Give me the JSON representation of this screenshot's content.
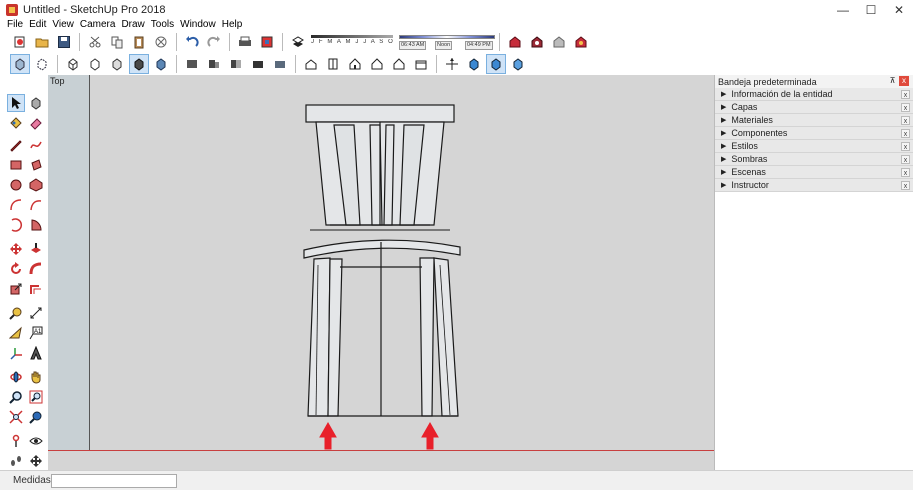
{
  "window": {
    "title": "Untitled - SketchUp Pro 2018",
    "controls": [
      "—",
      "☐",
      "✕"
    ]
  },
  "menu": [
    "File",
    "Edit",
    "View",
    "Camera",
    "Draw",
    "Tools",
    "Window",
    "Help"
  ],
  "shadow": {
    "months": "J F M A M J J A S O N D",
    "time_start": "06:43 AM",
    "time_mid": "Noon",
    "time_end": "04:49 PM"
  },
  "viewport": {
    "view_label": "Top"
  },
  "tray": {
    "title": "Bandeja predeterminada",
    "pin_glyph": "⊼",
    "close_glyph": "x",
    "panels": [
      {
        "label": "Información de la entidad"
      },
      {
        "label": "Capas"
      },
      {
        "label": "Materiales"
      },
      {
        "label": "Componentes"
      },
      {
        "label": "Estilos"
      },
      {
        "label": "Sombras"
      },
      {
        "label": "Escenas"
      },
      {
        "label": "Instructor"
      }
    ]
  },
  "status": {
    "measure_label": "Medidas",
    "measure_value": ""
  },
  "colors": {
    "viewport_bg": "#d5d5d5",
    "arrow_red": "#e8202a",
    "model_line": "#1a1a1a",
    "chair_fill": "#e4e6e8"
  }
}
